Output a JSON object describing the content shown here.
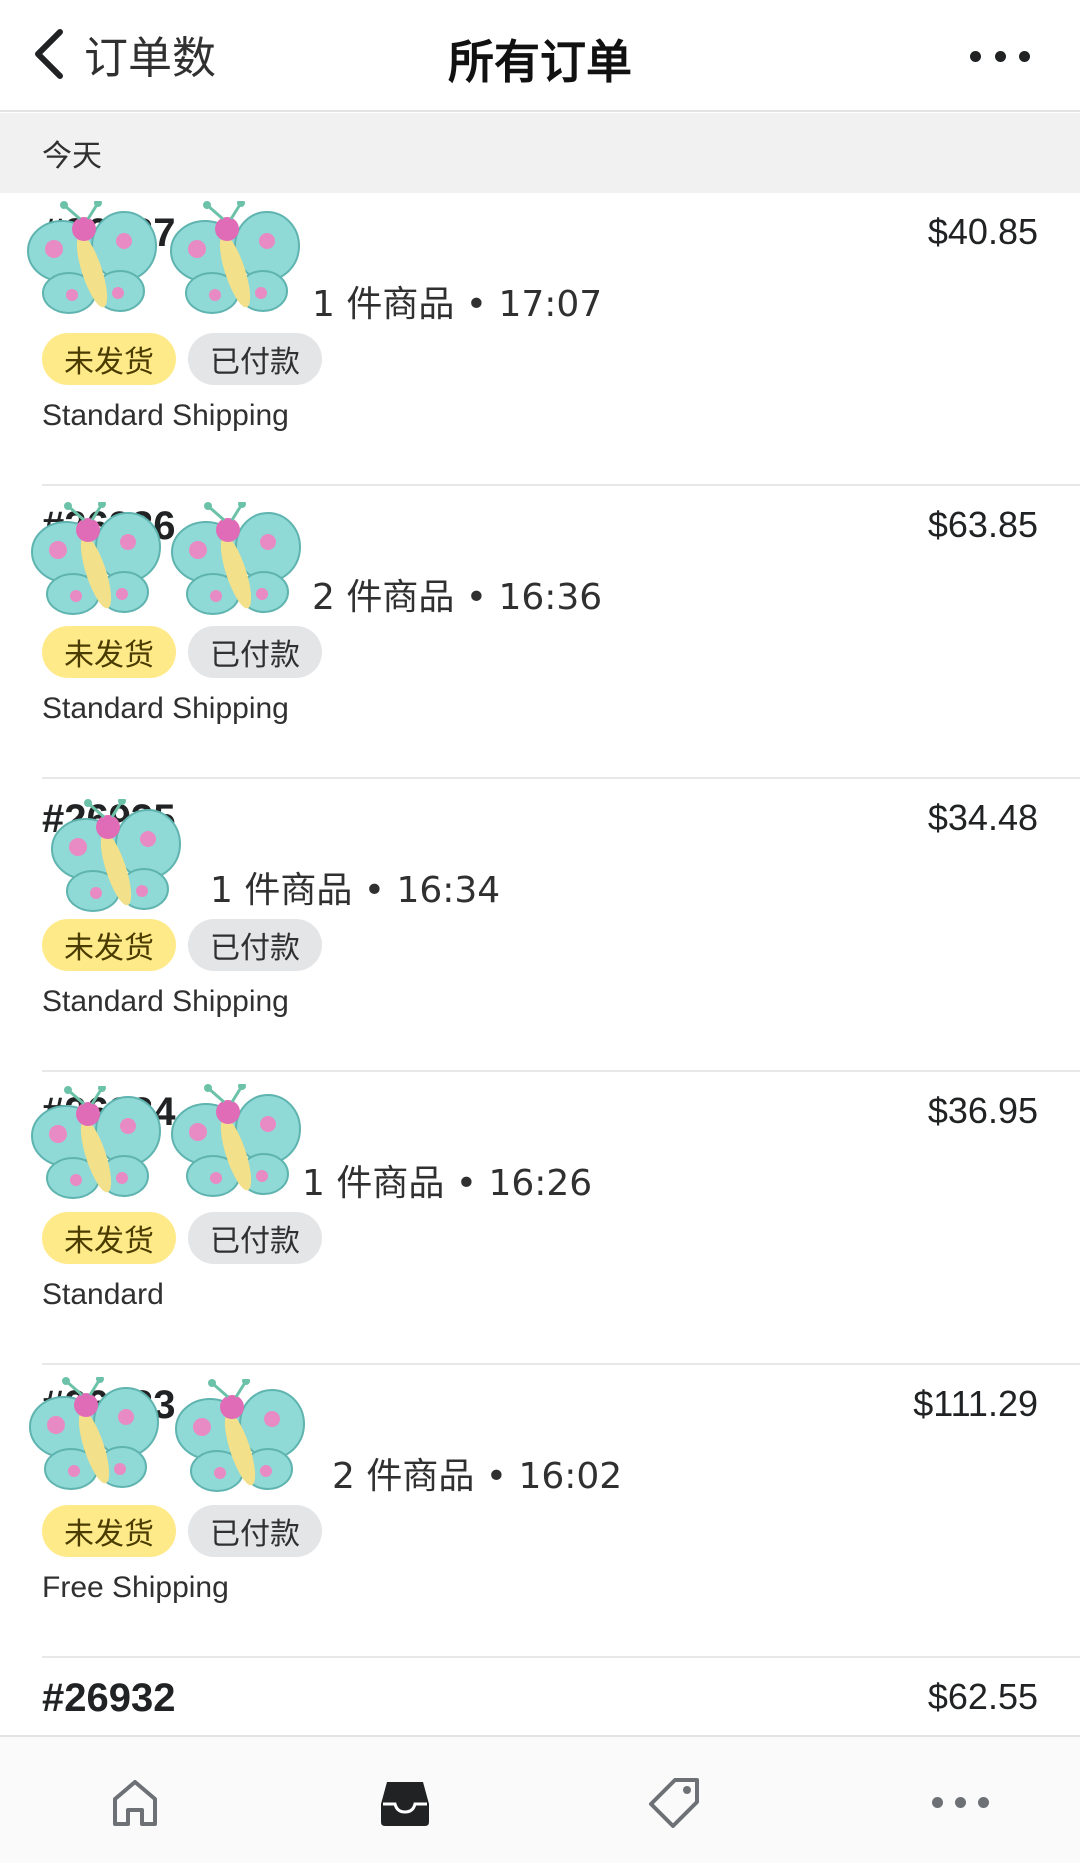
{
  "header": {
    "back_label": "订单数",
    "title": "所有订单"
  },
  "section": {
    "title": "今天"
  },
  "orders": [
    {
      "number": "#26937",
      "total": "$40.85",
      "meta": "1 件商品 • 17:07",
      "badge_fulfillment": "未发货",
      "badge_payment": "已付款",
      "shipping": "Standard Shipping"
    },
    {
      "number": "#26936",
      "total": "$63.85",
      "meta": "2 件商品 • 16:36",
      "badge_fulfillment": "未发货",
      "badge_payment": "已付款",
      "shipping": "Standard Shipping"
    },
    {
      "number": "#26935",
      "total": "$34.48",
      "meta": "1 件商品 • 16:34",
      "badge_fulfillment": "未发货",
      "badge_payment": "已付款",
      "shipping": "Standard Shipping"
    },
    {
      "number": "#26934",
      "total": "$36.95",
      "meta": "1 件商品 • 16:26",
      "badge_fulfillment": "未发货",
      "badge_payment": "已付款",
      "shipping": "Standard"
    },
    {
      "number": "#26933",
      "total": "$111.29",
      "meta": "2 件商品 • 16:02",
      "badge_fulfillment": "未发货",
      "badge_payment": "已付款",
      "shipping": "Free Shipping"
    },
    {
      "number": "#26932",
      "total": "$62.55"
    }
  ],
  "tabbar": {
    "icons": [
      "home-icon",
      "inbox-icon",
      "tag-icon",
      "more-icon"
    ]
  },
  "colors": {
    "unfulfilled_badge": "#ffea8a",
    "paid_badge": "#e4e5e7",
    "section_bg": "#f1f1f1"
  }
}
